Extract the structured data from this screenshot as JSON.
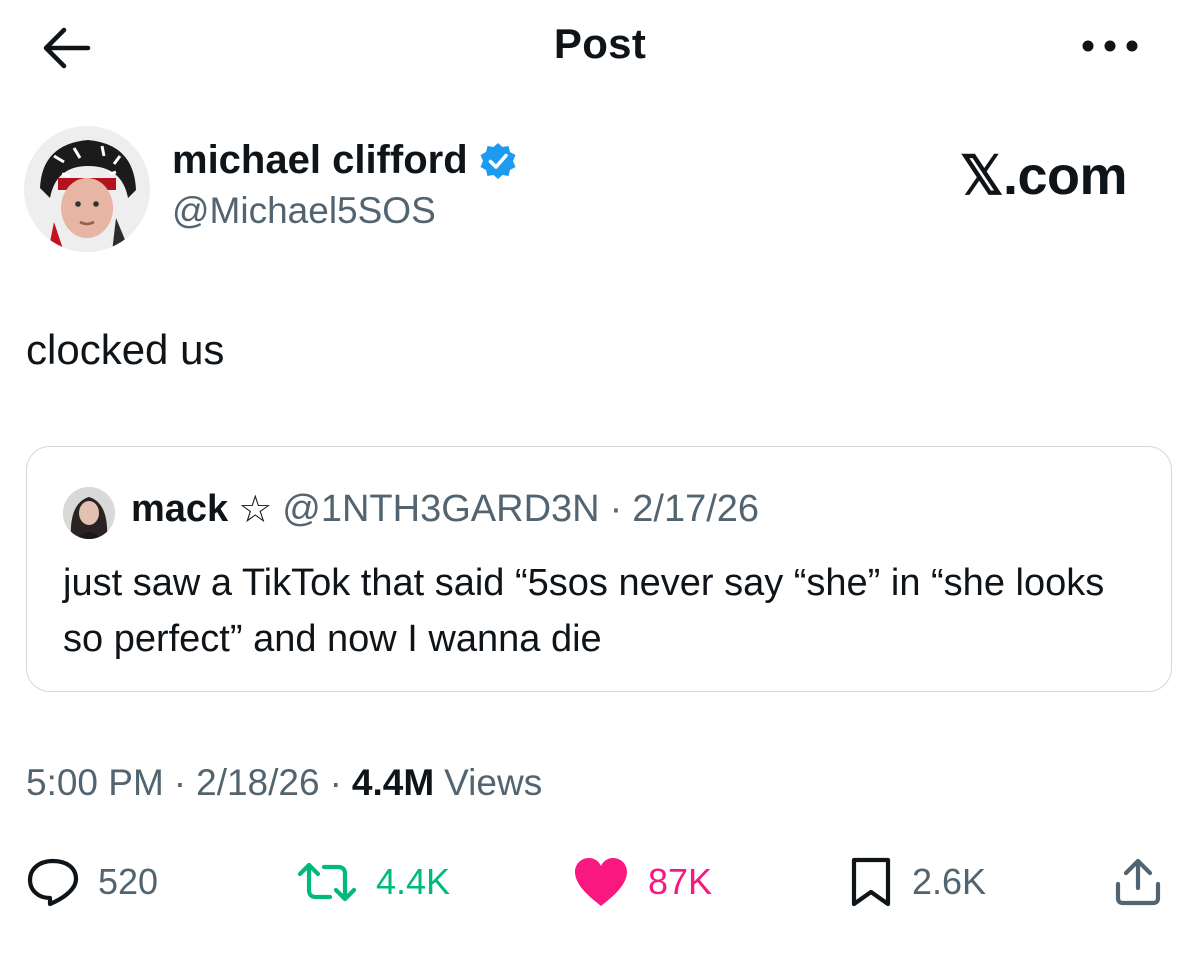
{
  "header": {
    "title": "Post"
  },
  "author": {
    "name": "michael clifford",
    "handle": "@Michael5SOS",
    "verified": true
  },
  "watermark": {
    "logo_text": "𝕏.com"
  },
  "post": {
    "text": "clocked us"
  },
  "quoted_post": {
    "name": "mack",
    "name_suffix": "☆",
    "handle": "@1NTH3GARD3N",
    "separator": "·",
    "date": "2/17/26",
    "text": "just saw a TikTok that said “5sos never say “she” in “she looks so perfect” and now I wanna die"
  },
  "meta": {
    "time": "5:00 PM",
    "sep1": "·",
    "date": "2/18/26",
    "sep2": "·",
    "views_count": "4.4M",
    "views_label": "Views"
  },
  "actions": {
    "replies": "520",
    "reposts": "4.4K",
    "likes": "87K",
    "bookmarks": "2.6K"
  },
  "colors": {
    "verified_blue": "#1d9bf0",
    "repost_green": "#00ba7c",
    "like_pink": "#f91880",
    "secondary_gray": "#536471",
    "border": "#cfd9de"
  },
  "icons": {
    "back": "arrow-left-icon",
    "more": "more-horizontal-icon",
    "verified": "verified-badge-icon",
    "reply": "reply-icon",
    "repost": "repost-icon",
    "like": "heart-icon",
    "bookmark": "bookmark-icon",
    "share": "share-icon"
  }
}
